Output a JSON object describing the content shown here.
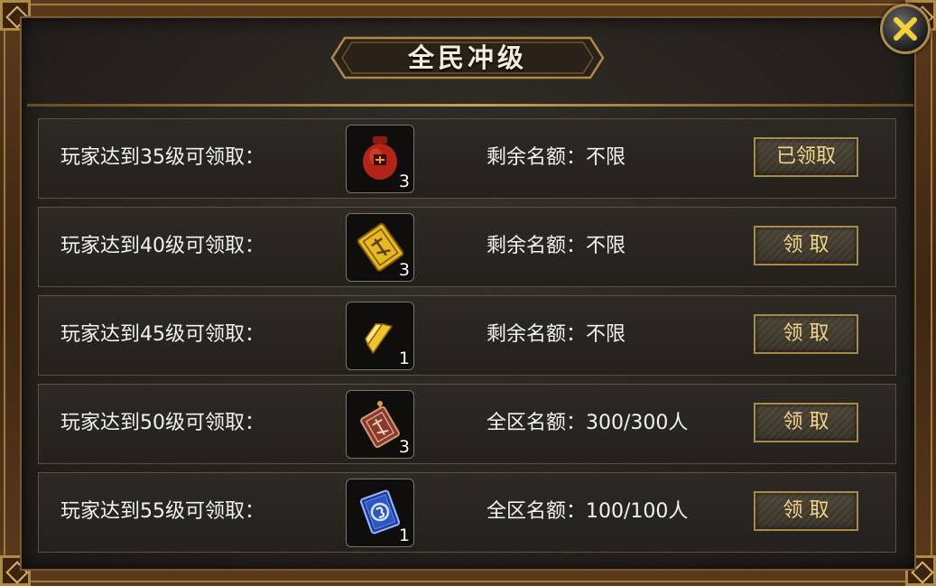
{
  "title": "全民冲级",
  "close_icon": "close-x-icon",
  "rows": [
    {
      "label": "玩家达到35级可领取：",
      "item_icon": "red-jar-icon",
      "count": "3",
      "quota": "剩余名额：不限",
      "button": "已领取"
    },
    {
      "label": "玩家达到40级可领取：",
      "item_icon": "gold-ticket-icon",
      "count": "3",
      "quota": "剩余名额：不限",
      "button": "领 取"
    },
    {
      "label": "玩家达到45级可领取：",
      "item_icon": "gold-bar-icon",
      "count": "1",
      "quota": "剩余名额：不限",
      "button": "领 取"
    },
    {
      "label": "玩家达到50级可领取：",
      "item_icon": "red-token-icon",
      "count": "3",
      "quota": "全区名额：300/300人",
      "button": "领 取"
    },
    {
      "label": "玩家达到55级可领取：",
      "item_icon": "blue-book-icon",
      "count": "1",
      "quota": "全区名额：100/100人",
      "button": "领 取"
    }
  ],
  "colors": {
    "frame": "#5a3a1c",
    "gold_border": "#a88a4c",
    "button_text": "#f1d58a",
    "text": "#f2f2f2"
  }
}
